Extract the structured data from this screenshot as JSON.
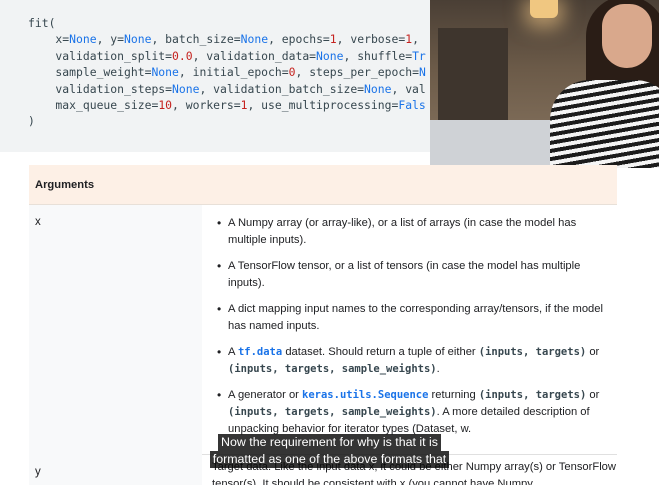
{
  "code": {
    "lines": [
      [
        {
          "t": "fit(",
          "c": "p"
        }
      ],
      [
        {
          "t": "    x=",
          "c": "p"
        },
        {
          "t": "None",
          "c": "k"
        },
        {
          "t": ", y=",
          "c": "p"
        },
        {
          "t": "None",
          "c": "k"
        },
        {
          "t": ", batch_size=",
          "c": "p"
        },
        {
          "t": "None",
          "c": "k"
        },
        {
          "t": ", epochs=",
          "c": "p"
        },
        {
          "t": "1",
          "c": "n"
        },
        {
          "t": ", verbose=",
          "c": "p"
        },
        {
          "t": "1",
          "c": "n"
        },
        {
          "t": ",",
          "c": "p"
        }
      ],
      [
        {
          "t": "    validation_split=",
          "c": "p"
        },
        {
          "t": "0.0",
          "c": "n"
        },
        {
          "t": ", validation_data=",
          "c": "p"
        },
        {
          "t": "None",
          "c": "k"
        },
        {
          "t": ", shuffle=",
          "c": "p"
        },
        {
          "t": "Tr",
          "c": "k"
        }
      ],
      [
        {
          "t": "    sample_weight=",
          "c": "p"
        },
        {
          "t": "None",
          "c": "k"
        },
        {
          "t": ", initial_epoch=",
          "c": "p"
        },
        {
          "t": "0",
          "c": "n"
        },
        {
          "t": ", steps_per_epoch=",
          "c": "p"
        },
        {
          "t": "N",
          "c": "k"
        }
      ],
      [
        {
          "t": "    validation_steps=",
          "c": "p"
        },
        {
          "t": "None",
          "c": "k"
        },
        {
          "t": ", validation_batch_size=",
          "c": "p"
        },
        {
          "t": "None",
          "c": "k"
        },
        {
          "t": ", val",
          "c": "p"
        }
      ],
      [
        {
          "t": "    max_queue_size=",
          "c": "p"
        },
        {
          "t": "10",
          "c": "n"
        },
        {
          "t": ", workers=",
          "c": "p"
        },
        {
          "t": "1",
          "c": "n"
        },
        {
          "t": ", use_multiprocessing=",
          "c": "p"
        },
        {
          "t": "Fals",
          "c": "k"
        }
      ],
      [
        {
          "t": ")",
          "c": "p"
        }
      ]
    ]
  },
  "table": {
    "header": "Arguments",
    "rows": {
      "x": {
        "name": "x",
        "bullets": [
          [
            {
              "t": "A Numpy array (or array-like), or a list of arrays (in case the model has multiple inputs).",
              "c": "p"
            }
          ],
          [
            {
              "t": "A TensorFlow tensor, or a list of tensors (in case the model has multiple inputs).",
              "c": "p"
            }
          ],
          [
            {
              "t": "A dict mapping input names to the corresponding array/tensors, if the model has named inputs.",
              "c": "p"
            }
          ],
          [
            {
              "t": "A ",
              "c": "p"
            },
            {
              "t": "tf.data",
              "c": "l"
            },
            {
              "t": " dataset. Should return a tuple of either ",
              "c": "p"
            },
            {
              "t": "(inputs, targets)",
              "c": "m"
            },
            {
              "t": " or ",
              "c": "p"
            },
            {
              "t": "(inputs, targets, sample_weights)",
              "c": "m"
            },
            {
              "t": ".",
              "c": "p"
            }
          ],
          [
            {
              "t": "A generator or ",
              "c": "p"
            },
            {
              "t": "keras.utils.Sequence",
              "c": "l"
            },
            {
              "t": " returning ",
              "c": "p"
            },
            {
              "t": "(inputs, targets)",
              "c": "m"
            },
            {
              "t": " or ",
              "c": "p"
            },
            {
              "t": "(inputs, targets, sample_weights)",
              "c": "m"
            },
            {
              "t": ". A more detailed description of unpacking behavior for iterator types (Dataset, ",
              "c": "p"
            },
            {
              "t": "w.",
              "c": "p"
            }
          ]
        ]
      },
      "y": {
        "name": "y",
        "description": "Target data. Like the input data x, it could be either Numpy array(s) or TensorFlow tensor(s). It should be consistent with x (you cannot have Numpy"
      }
    }
  },
  "captions": {
    "line1": "Now the requirement for why is that it is",
    "line2": "formatted as one of the above formats that"
  }
}
